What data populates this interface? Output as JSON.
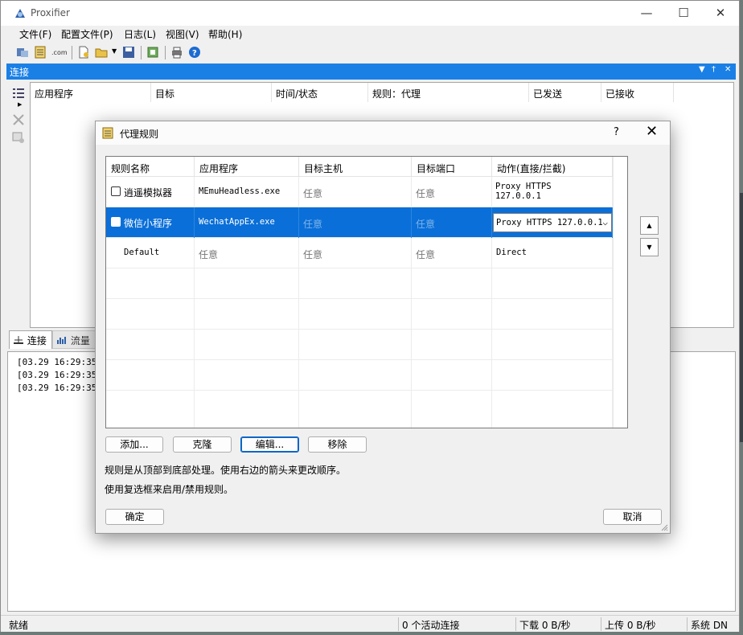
{
  "window": {
    "title": "Proxifier",
    "minimize_glyph": "—",
    "maximize_glyph": "☐",
    "close_glyph": "✕"
  },
  "menu": [
    "文件(F)",
    "配置文件(P)",
    "日志(L)",
    "视图(V)",
    "帮助(H)"
  ],
  "panel": {
    "title": "连接",
    "controls": [
      "▼",
      "†",
      "✕"
    ]
  },
  "connections": {
    "columns": [
      "应用程序",
      "目标",
      "时间/状态",
      "规则：代理",
      "已发送",
      "已接收"
    ]
  },
  "tabs": [
    {
      "label": "连接",
      "icon": "connections-icon"
    },
    {
      "label": "流量",
      "icon": "traffic-icon"
    }
  ],
  "log_lines": [
    "[03.29 16:29:35]",
    "[03.29 16:29:35]",
    "[03.29 16:29:35]"
  ],
  "statusbar": {
    "ready": "就绪",
    "active": "0 个活动连接",
    "download": "下载 0 B/秒",
    "upload": "上传 0 B/秒",
    "system": "系统 DN"
  },
  "dialog": {
    "title": "代理规则",
    "help": "?",
    "close": "✕",
    "columns": [
      "规则名称",
      "应用程序",
      "目标主机",
      "目标端口",
      "动作(直接/拦截)"
    ],
    "rules": [
      {
        "name": "逍遥模拟器",
        "application": "MEmuHeadless.exe",
        "target_hosts": "任意",
        "target_ports": "任意",
        "action": "Proxy HTTPS 127.0.0.1",
        "action_lines": [
          "Proxy HTTPS",
          "127.0.0.1"
        ],
        "enabled": false,
        "selected": false,
        "has_checkbox": true
      },
      {
        "name": "微信小程序",
        "application": "WechatAppEx.exe",
        "target_hosts": "任意",
        "target_ports": "任意",
        "action": "Proxy HTTPS 127.0.0.1",
        "action_lines": [
          "Proxy HTTPS 127.0.0.1"
        ],
        "enabled": false,
        "selected": true,
        "has_checkbox": true
      },
      {
        "name": "Default",
        "application": "任意",
        "target_hosts": "任意",
        "target_ports": "任意",
        "action": "Direct",
        "action_lines": [
          "Direct"
        ],
        "enabled": true,
        "selected": false,
        "has_checkbox": false
      }
    ],
    "move_up": "▲",
    "move_down": "▼",
    "buttons": {
      "add": "添加...",
      "clone": "克隆",
      "edit": "编辑...",
      "remove": "移除"
    },
    "note1": "规则是从顶部到底部处理。使用右边的箭头来更改顺序。",
    "note2": "使用复选框来启用/禁用规则。",
    "ok": "确定",
    "cancel": "取消"
  },
  "colors": {
    "panel_header": "#1a80e6",
    "selection": "#0a6fd8",
    "focus_border": "#0a66c8"
  }
}
